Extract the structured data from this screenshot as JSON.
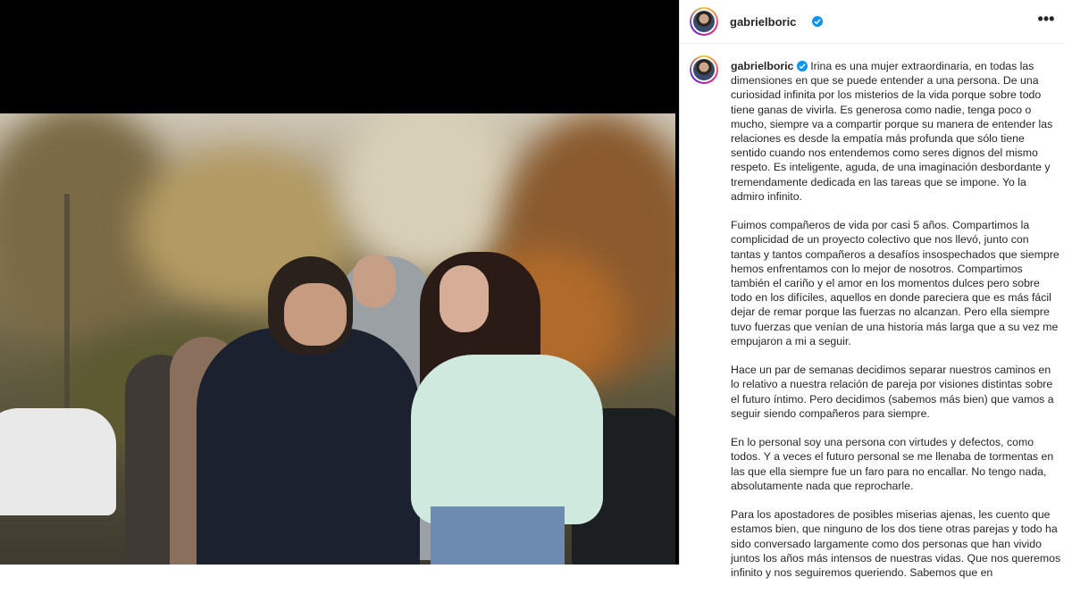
{
  "post": {
    "username": "gabrielboric",
    "icons": {
      "verified": "verified-badge-icon",
      "more": "more-options-icon",
      "avatar": "profile-avatar"
    },
    "more_label": "•••",
    "caption_paragraphs": [
      "Irina es una mujer extraordinaria, en todas las dimensiones en que se puede entender a una persona. De una curiosidad infinita por los misterios de la vida porque sobre todo tiene ganas de vivirla. Es generosa como nadie, tenga poco o mucho, siempre va a compartir porque su manera de entender las relaciones es desde la empatía más profunda que sólo tiene sentido cuando nos entendemos como seres dignos del mismo respeto. Es inteligente, aguda, de una imaginación desbordante y tremendamente dedicada en las tareas que se impone. Yo la admiro infinito.",
      "Fuimos compañeros de vida por casi 5 años. Compartimos la complicidad de un proyecto colectivo que nos llevó, junto con tantas y tantos compañeros a desafíos insospechados que siempre hemos enfrentamos con lo mejor de nosotros. Compartimos también el cariño y el amor en los momentos dulces pero sobre todo en los difíciles, aquellos en donde pareciera que es más fácil dejar de remar porque las fuerzas no alcanzan. Pero ella siempre tuvo fuerzas que venían de una historia más larga que a su vez me empujaron a mi a seguir.",
      "Hace un par de semanas decidimos separar nuestros caminos en lo relativo a nuestra relación de pareja por visiones distintas sobre el futuro íntimo. Pero decidimos (sabemos más bien) que vamos a seguir siendo compañeros para siempre.",
      "En lo personal soy una persona con virtudes y defectos, como todos. Y a veces el futuro personal se me llenaba de tormentas en las que ella siempre fue un faro para no encallar. No tengo nada, absolutamente nada que reprocharle.",
      "Para los apostadores de posibles miserias ajenas, les cuento que estamos bien, que ninguno de los dos tiene otras parejas y todo ha sido conversado largamente como dos personas que han vivido juntos los años más intensos de nuestras vidas. Que nos queremos infinito y nos seguiremos queriendo. Sabemos que en"
    ]
  }
}
